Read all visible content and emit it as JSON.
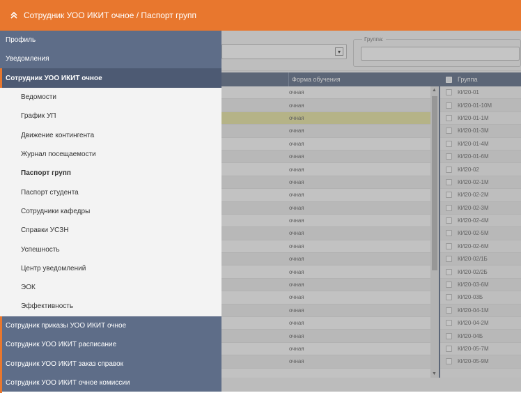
{
  "header": {
    "title": "Сотрудник УОО ИКИТ очное / Паспорт групп"
  },
  "filters": {
    "group_label": "Группа:"
  },
  "sidebar": {
    "top_items": [
      "Профиль",
      "Уведомления"
    ],
    "active_section": "Сотрудник УОО ИКИТ очное",
    "sub_items": [
      {
        "label": "Ведомости",
        "active": false
      },
      {
        "label": "График УП",
        "active": false
      },
      {
        "label": "Движение контингента",
        "active": false
      },
      {
        "label": "Журнал посещаемости",
        "active": false
      },
      {
        "label": "Паспорт групп",
        "active": true
      },
      {
        "label": "Паспорт студента",
        "active": false
      },
      {
        "label": "Сотрудники кафедры",
        "active": false
      },
      {
        "label": "Справки УСЗН",
        "active": false
      },
      {
        "label": "Успешность",
        "active": false
      },
      {
        "label": "Центр уведомлений",
        "active": false
      },
      {
        "label": "ЭОК",
        "active": false
      },
      {
        "label": "Эффективность",
        "active": false
      }
    ],
    "bottom_items": [
      "Сотрудник приказы УОО ИКИТ очное",
      "Сотрудник УОО ИКИТ расписание",
      "Сотрудник УОО ИКИТ заказ справок",
      "Сотрудник УОО ИКИТ очное комиссии"
    ]
  },
  "grid_main": {
    "column_header": "Форма обучения",
    "rows": [
      "очная",
      "очная",
      "очная",
      "очная",
      "очная",
      "очная",
      "очная",
      "очная",
      "очная",
      "очная",
      "очная",
      "очная",
      "очная",
      "очная",
      "очная",
      "очная",
      "очная",
      "очная",
      "очная",
      "очная",
      "очная",
      "очная"
    ],
    "highlighted_row": 2
  },
  "grid_groups": {
    "column_header": "Группа",
    "rows": [
      "КИ20-01",
      "КИ20-01-10М",
      "КИ20-01-1М",
      "КИ20-01-3М",
      "КИ20-01-4М",
      "КИ20-01-6М",
      "КИ20-02",
      "КИ20-02-1М",
      "КИ20-02-2М",
      "КИ20-02-3М",
      "КИ20-02-4М",
      "КИ20-02-5М",
      "КИ20-02-6М",
      "КИ20-02/1Б",
      "КИ20-02/2Б",
      "КИ20-03-6М",
      "КИ20-03Б",
      "КИ20-04-1М",
      "КИ20-04-2М",
      "КИ20-04Б",
      "КИ20-05-7М",
      "КИ20-05-9М"
    ]
  },
  "colors": {
    "accent": "#e8772e",
    "sidebar": "#5e6d88",
    "highlight_row": "#e6e4a0"
  }
}
